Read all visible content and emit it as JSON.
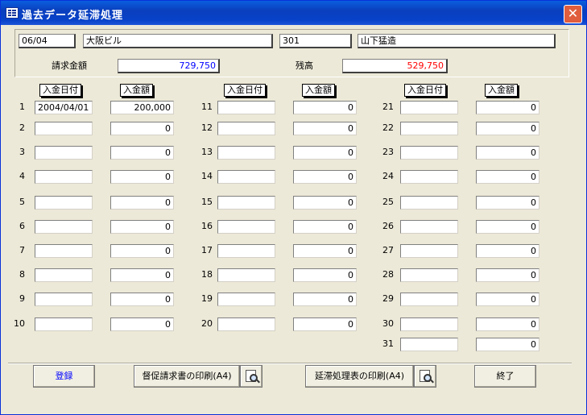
{
  "window": {
    "title": "過去データ延滞処理",
    "close_glyph": "✕",
    "icon": "form-icon"
  },
  "header": {
    "month": "06/04",
    "building": "大阪ビル",
    "room": "301",
    "tenant": "山下猛造",
    "billing_label": "請求金額",
    "billing_value": "729,750",
    "balance_label": "残高",
    "balance_value": "529,750",
    "billing_color": "#0000ff",
    "balance_color": "#ff0000"
  },
  "columns": {
    "date_header": "入金日付",
    "amount_header": "入金額"
  },
  "rows": [
    {
      "no": "1",
      "date": "2004/04/01",
      "amount": "200,000"
    },
    {
      "no": "2",
      "date": "",
      "amount": "0"
    },
    {
      "no": "3",
      "date": "",
      "amount": "0"
    },
    {
      "no": "4",
      "date": "",
      "amount": "0"
    },
    {
      "no": "5",
      "date": "",
      "amount": "0"
    },
    {
      "no": "6",
      "date": "",
      "amount": "0"
    },
    {
      "no": "7",
      "date": "",
      "amount": "0"
    },
    {
      "no": "8",
      "date": "",
      "amount": "0"
    },
    {
      "no": "9",
      "date": "",
      "amount": "0"
    },
    {
      "no": "10",
      "date": "",
      "amount": "0"
    },
    {
      "no": "11",
      "date": "",
      "amount": "0"
    },
    {
      "no": "12",
      "date": "",
      "amount": "0"
    },
    {
      "no": "13",
      "date": "",
      "amount": "0"
    },
    {
      "no": "14",
      "date": "",
      "amount": "0"
    },
    {
      "no": "15",
      "date": "",
      "amount": "0"
    },
    {
      "no": "16",
      "date": "",
      "amount": "0"
    },
    {
      "no": "17",
      "date": "",
      "amount": "0"
    },
    {
      "no": "18",
      "date": "",
      "amount": "0"
    },
    {
      "no": "19",
      "date": "",
      "amount": "0"
    },
    {
      "no": "20",
      "date": "",
      "amount": "0"
    },
    {
      "no": "21",
      "date": "",
      "amount": "0"
    },
    {
      "no": "22",
      "date": "",
      "amount": "0"
    },
    {
      "no": "23",
      "date": "",
      "amount": "0"
    },
    {
      "no": "24",
      "date": "",
      "amount": "0"
    },
    {
      "no": "25",
      "date": "",
      "amount": "0"
    },
    {
      "no": "26",
      "date": "",
      "amount": "0"
    },
    {
      "no": "27",
      "date": "",
      "amount": "0"
    },
    {
      "no": "28",
      "date": "",
      "amount": "0"
    },
    {
      "no": "29",
      "date": "",
      "amount": "0"
    },
    {
      "no": "30",
      "date": "",
      "amount": "0"
    },
    {
      "no": "31",
      "date": "",
      "amount": "0"
    }
  ],
  "buttons": {
    "register": "登録",
    "print_reminder": "督促請求書の印刷(A4)",
    "print_overdue": "延滞処理表の印刷(A4)",
    "exit": "終了",
    "preview_icon": "print-preview-icon"
  }
}
